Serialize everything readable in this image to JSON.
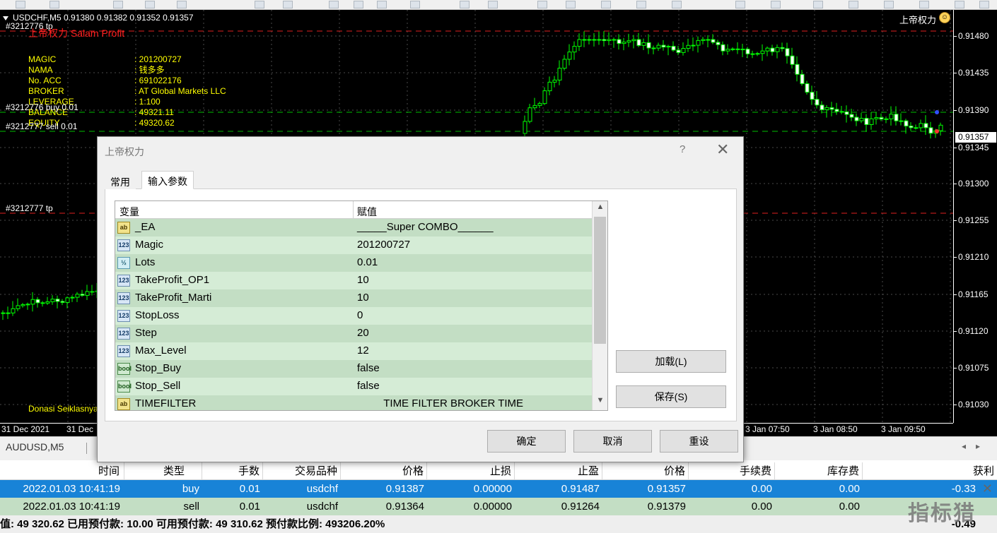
{
  "chart": {
    "symbol_header": "USDCHF,M5  0.91380 0.91382 0.91352 0.91357",
    "ea_name": "上帝权力",
    "ea_label": "上帝权力 Salam Profit",
    "order_labels": {
      "tp1": "#3212776 tp",
      "buy": "#3212776 buy 0.01",
      "sell": "#3212777 sell 0.01",
      "tp2": "#3212777 tp"
    },
    "info": [
      {
        "key": "MAGIC",
        "value": ": 201200727"
      },
      {
        "key": "NAMA",
        "value": ": 钱多多"
      },
      {
        "key": "No. ACC",
        "value": ": 691022176"
      },
      {
        "key": "BROKER",
        "value": ": AT Global Markets LLC"
      },
      {
        "key": "LEVERAGE",
        "value": ": 1:100"
      },
      {
        "key": "BALANCE",
        "value": ": 49321.11"
      },
      {
        "key": "EQUITY",
        "value": ": 49320.62"
      }
    ],
    "donasi": "Donasi Seiklasnya",
    "current_price": "0.91357",
    "price_labels": [
      "0.91480",
      "0.91435",
      "0.91390",
      "0.91345",
      "0.91300",
      "0.91255",
      "0.91210",
      "0.91165",
      "0.91120",
      "0.91075",
      "0.91030"
    ],
    "time_labels": [
      "31 Dec 2021",
      "31 Dec",
      "3 Jan 07:50",
      "3 Jan 08:50",
      "3 Jan 09:50"
    ],
    "colors": {
      "bull": "#00ff00",
      "bear": "#ffffff",
      "dash_green": "#00c000",
      "dash_red": "#e02020"
    }
  },
  "chart_tabs": {
    "tab1": "AUDUSD,M5"
  },
  "dialog": {
    "title": "上帝权力",
    "help": "?",
    "close": "✕",
    "tabs": {
      "common": "常用",
      "inputs": "输入参数"
    },
    "columns": {
      "variable": "变量",
      "value": "赋值"
    },
    "params": [
      {
        "icon": "ab",
        "name": "_EA",
        "value": "_____Super COMBO______"
      },
      {
        "icon": "123",
        "name": "Magic",
        "value": "201200727"
      },
      {
        "icon": "½",
        "name": "Lots",
        "value": "0.01"
      },
      {
        "icon": "123",
        "name": "TakeProfit_OP1",
        "value": "10"
      },
      {
        "icon": "123",
        "name": "TakeProfit_Marti",
        "value": "10"
      },
      {
        "icon": "123",
        "name": "StopLoss",
        "value": "0"
      },
      {
        "icon": "123",
        "name": "Step",
        "value": "20"
      },
      {
        "icon": "123",
        "name": "Max_Level",
        "value": "12"
      },
      {
        "icon": "bool",
        "name": "Stop_Buy",
        "value": "false"
      },
      {
        "icon": "bool",
        "name": "Stop_Sell",
        "value": "false"
      },
      {
        "icon": "ab",
        "name": " TIMEFILTER",
        "value": "         TIME FILTER BROKER TIME"
      }
    ],
    "buttons": {
      "load": "加载(L)",
      "save": "保存(S)",
      "ok": "确定",
      "cancel": "取消",
      "reset": "重设"
    }
  },
  "terminal": {
    "headers": [
      "时间",
      "类型",
      "手数",
      "交易品种",
      "价格",
      "止损",
      "止盈",
      "价格",
      "手续费",
      "库存费",
      "获利"
    ],
    "rows": [
      [
        "2022.01.03 10:41:19",
        "buy",
        "0.01",
        "usdchf",
        "0.91387",
        "0.00000",
        "0.91487",
        "0.91357",
        "0.00",
        "0.00",
        "-0.33"
      ],
      [
        "2022.01.03 10:41:19",
        "sell",
        "0.01",
        "usdchf",
        "0.91364",
        "0.00000",
        "0.91264",
        "0.91379",
        "0.00",
        "0.00",
        ""
      ]
    ],
    "balance_line": "值: 49 320.62  已用预付款: 10.00  可用预付款: 49 310.62  预付款比例: 493206.20%",
    "total_profit": "-0.49",
    "watermark": "指标猎"
  }
}
